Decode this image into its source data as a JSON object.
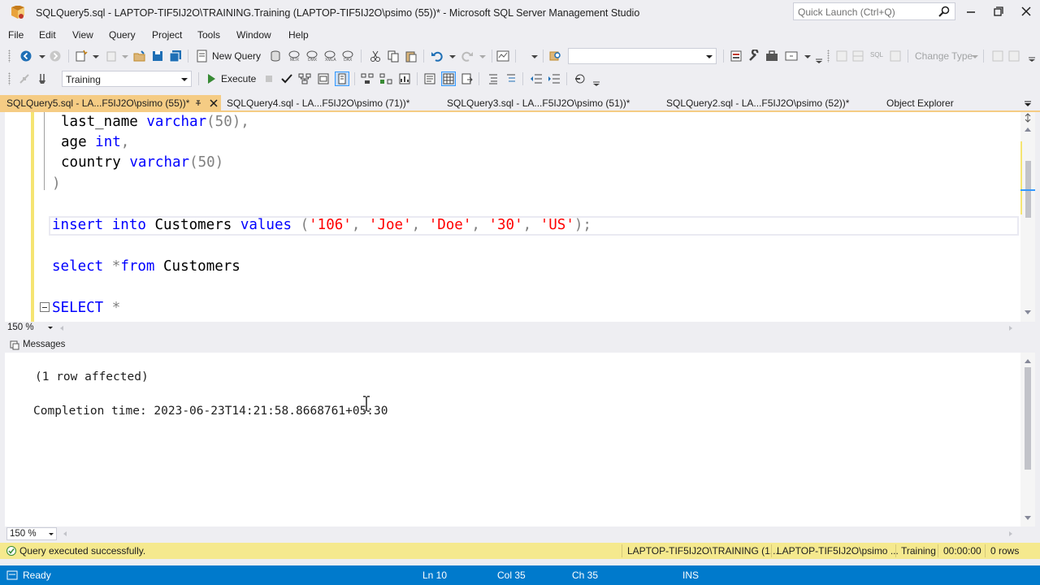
{
  "window": {
    "title": "SQLQuery5.sql - LAPTOP-TIF5IJ2O\\TRAINING.Training (LAPTOP-TIF5IJ2O\\psimo (55))* - Microsoft SQL Server Management Studio",
    "quick_launch_placeholder": "Quick Launch (Ctrl+Q)"
  },
  "menu": [
    "File",
    "Edit",
    "View",
    "Query",
    "Project",
    "Tools",
    "Window",
    "Help"
  ],
  "toolbar1": {
    "new_query_label": "New Query",
    "change_type_label": "Change Type"
  },
  "toolbar2": {
    "database": "Training",
    "execute_label": "Execute"
  },
  "tabs": [
    {
      "label": "SQLQuery5.sql - LA...F5IJ2O\\psimo (55))*",
      "active": true
    },
    {
      "label": "SQLQuery4.sql - LA...F5IJ2O\\psimo (71))*",
      "active": false
    },
    {
      "label": "SQLQuery3.sql - LA...F5IJ2O\\psimo (51))*",
      "active": false
    },
    {
      "label": "SQLQuery2.sql - LA...F5IJ2O\\psimo (52))*",
      "active": false
    },
    {
      "label": "Object Explorer",
      "active": false
    }
  ],
  "editor": {
    "lines": {
      "l1_ident": "last_name",
      "l1_type": "varchar",
      "l1_rest": "(50),",
      "l2_ident": "age",
      "l2_type": "int",
      "l2_rest": ",",
      "l3_ident": "country",
      "l3_type": "varchar",
      "l3_rest": "(50)",
      "l4": ")",
      "l5_insert": "insert into",
      "l5_table": "Customers",
      "l5_values": "values",
      "l5_open": "(",
      "l5_v1": "'106'",
      "l5_v2": "'Joe'",
      "l5_v3": "'Doe'",
      "l5_v4": "'30'",
      "l5_v5": "'US'",
      "l5_close": ");",
      "comma": ",",
      "l6_select": "select",
      "l6_star": "*",
      "l6_from": "from",
      "l6_table": "Customers",
      "l7_select": "SELECT",
      "l7_star": "*"
    },
    "zoom": "150 %"
  },
  "messages": {
    "tab_label": "Messages",
    "line1": "(1 row affected)",
    "line2": "Completion time: 2023-06-23T14:21:58.8668761+05:30",
    "zoom": "150 %"
  },
  "query_status": {
    "message": "Query executed successfully.",
    "server": "LAPTOP-TIF5IJ2O\\TRAINING (1...",
    "user": "LAPTOP-TIF5IJ2O\\psimo ...",
    "database": "Training",
    "elapsed": "00:00:00",
    "rows": "0 rows"
  },
  "status_bar": {
    "state": "Ready",
    "line": "Ln 10",
    "col": "Col 35",
    "ch": "Ch 35",
    "mode": "INS"
  },
  "colors": {
    "status_blue": "#007acc",
    "tab_active": "#f5cc84",
    "query_status_bar": "#f5e98e",
    "keyword": "#0000ff",
    "string": "#ff0000"
  }
}
